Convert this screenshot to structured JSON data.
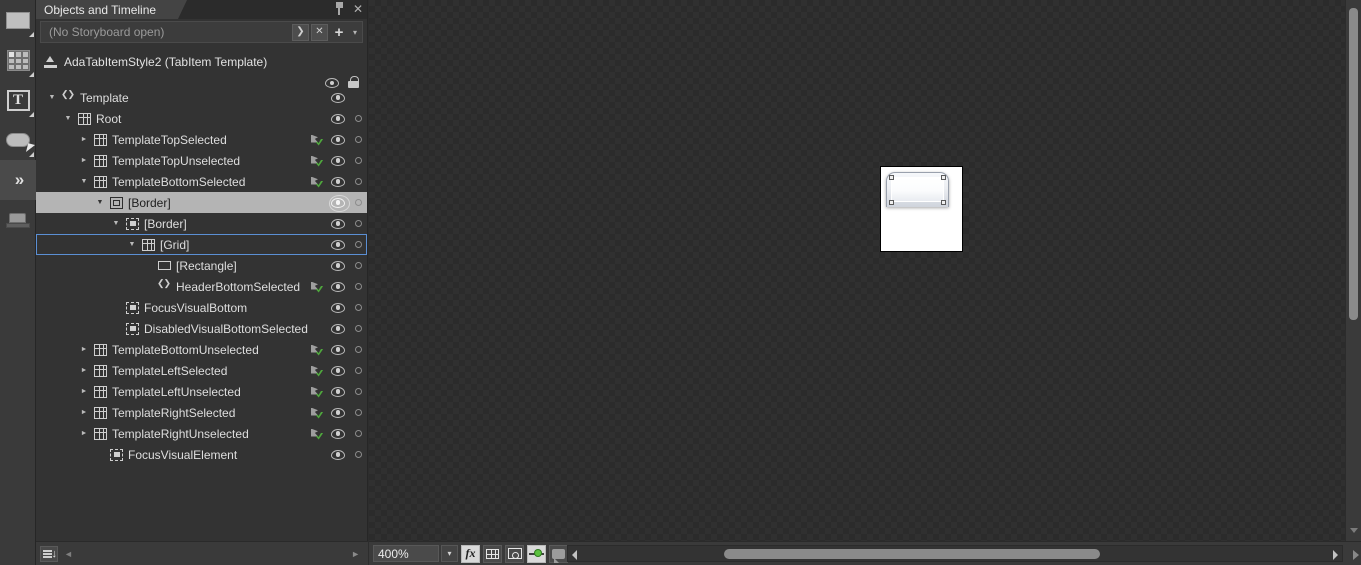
{
  "toolbar": {
    "tools": [
      {
        "name": "selection-rectangle-tool",
        "icon": "rectangle-icon"
      },
      {
        "name": "grid-panel-tool",
        "icon": "grid-icon"
      },
      {
        "name": "text-tool",
        "icon": "text-icon",
        "glyph": "T"
      },
      {
        "name": "button-control-tool",
        "icon": "button-icon"
      },
      {
        "name": "assets-tool",
        "icon": "double-chevron-right-icon",
        "glyph": "»"
      },
      {
        "name": "camera-3d-tool",
        "icon": "camera-icon"
      }
    ]
  },
  "panel": {
    "tab_label": "Objects and Timeline",
    "pin_tooltip": "Pin",
    "close_tooltip": "Close",
    "storyboard": {
      "value": "(No Storyboard open)",
      "placeholder": "(No Storyboard open)",
      "picker_glyph": "❯",
      "close_glyph": "✕",
      "new_glyph": "+",
      "menu_glyph": "▾"
    },
    "breadcrumb": "AdaTabItemStyle2 (TabItem Template)",
    "column_headers": {
      "visibility": "eye-icon",
      "lock": "lock-icon"
    },
    "tree": [
      {
        "label": "Template",
        "depth": 0,
        "twisty": "down",
        "icon": "template-icon",
        "anim": false,
        "eye": true,
        "lock": false,
        "selected": false,
        "focused": false
      },
      {
        "label": "Root",
        "depth": 1,
        "twisty": "down",
        "icon": "grid-icon",
        "anim": false,
        "eye": true,
        "lock": true,
        "selected": false,
        "focused": false
      },
      {
        "label": "TemplateTopSelected",
        "depth": 2,
        "twisty": "right",
        "icon": "grid-icon",
        "anim": true,
        "eye": true,
        "lock": true,
        "selected": false,
        "focused": false
      },
      {
        "label": "TemplateTopUnselected",
        "depth": 2,
        "twisty": "right",
        "icon": "grid-icon",
        "anim": true,
        "eye": true,
        "lock": true,
        "selected": false,
        "focused": false
      },
      {
        "label": "TemplateBottomSelected",
        "depth": 2,
        "twisty": "down",
        "icon": "grid-icon",
        "anim": true,
        "eye": true,
        "lock": true,
        "selected": false,
        "focused": false
      },
      {
        "label": "[Border]",
        "depth": 3,
        "twisty": "down",
        "icon": "border-icon",
        "anim": false,
        "eye": true,
        "lock": true,
        "selected": true,
        "focused": false
      },
      {
        "label": "[Border]",
        "depth": 4,
        "twisty": "down",
        "icon": "dashed-border-icon",
        "anim": false,
        "eye": true,
        "lock": true,
        "selected": false,
        "focused": false
      },
      {
        "label": "[Grid]",
        "depth": 5,
        "twisty": "down",
        "icon": "grid-icon",
        "anim": false,
        "eye": true,
        "lock": true,
        "selected": false,
        "focused": true
      },
      {
        "label": "[Rectangle]",
        "depth": 6,
        "twisty": "none",
        "icon": "rectangle-icon",
        "anim": false,
        "eye": true,
        "lock": true,
        "selected": false,
        "focused": false
      },
      {
        "label": "HeaderBottomSelected",
        "depth": 6,
        "twisty": "none",
        "icon": "template-icon",
        "anim": true,
        "eye": true,
        "lock": true,
        "selected": false,
        "focused": false
      },
      {
        "label": "FocusVisualBottom",
        "depth": 4,
        "twisty": "none",
        "icon": "dashed-border-icon",
        "anim": false,
        "eye": true,
        "lock": true,
        "selected": false,
        "focused": false
      },
      {
        "label": "DisabledVisualBottomSelected",
        "depth": 4,
        "twisty": "none",
        "icon": "dashed-border-icon",
        "anim": false,
        "eye": true,
        "lock": true,
        "selected": false,
        "focused": false
      },
      {
        "label": "TemplateBottomUnselected",
        "depth": 2,
        "twisty": "right",
        "icon": "grid-icon",
        "anim": true,
        "eye": true,
        "lock": true,
        "selected": false,
        "focused": false
      },
      {
        "label": "TemplateLeftSelected",
        "depth": 2,
        "twisty": "right",
        "icon": "grid-icon",
        "anim": true,
        "eye": true,
        "lock": true,
        "selected": false,
        "focused": false
      },
      {
        "label": "TemplateLeftUnselected",
        "depth": 2,
        "twisty": "right",
        "icon": "grid-icon",
        "anim": true,
        "eye": true,
        "lock": true,
        "selected": false,
        "focused": false
      },
      {
        "label": "TemplateRightSelected",
        "depth": 2,
        "twisty": "right",
        "icon": "grid-icon",
        "anim": true,
        "eye": true,
        "lock": true,
        "selected": false,
        "focused": false
      },
      {
        "label": "TemplateRightUnselected",
        "depth": 2,
        "twisty": "right",
        "icon": "grid-icon",
        "anim": true,
        "eye": true,
        "lock": true,
        "selected": false,
        "focused": false
      },
      {
        "label": "FocusVisualElement",
        "depth": 3,
        "twisty": "none",
        "icon": "dashed-border-icon",
        "anim": false,
        "eye": true,
        "lock": true,
        "selected": false,
        "focused": false
      }
    ],
    "bottom_bar": {
      "layers_icon": "show-all-layers-icon",
      "scroll_left_glyph": "◄",
      "scroll_right_glyph": "►"
    }
  },
  "canvas": {
    "artboard_label": "tab-item-preview",
    "scrollbars": {
      "h_left_glyph": "◄",
      "h_right_glyph": "►",
      "v_down_glyph": "▼"
    },
    "bottom_bar": {
      "zoom_value": "400%",
      "zoom_dropdown_glyph": "▾",
      "buttons": [
        {
          "name": "effects-toggle-button",
          "icon": "fx-icon",
          "glyph": "fx",
          "active": true
        },
        {
          "name": "show-grid-button",
          "icon": "grid-icon",
          "active": false
        },
        {
          "name": "snap-to-gridlines-button",
          "icon": "snap-icon",
          "active": false
        },
        {
          "name": "snap-to-snaplines-button",
          "icon": "align-icon",
          "active": true
        },
        {
          "name": "annotations-button",
          "icon": "comment-icon",
          "active": false
        }
      ],
      "collapse_glyph": "◄"
    }
  },
  "colors": {
    "panel_bg": "#333333",
    "toolbar_bg": "#3a3a3a",
    "selection_row": "#b4b4b4",
    "focus_outline": "#5b8fd4",
    "accent_green": "#5cc23f",
    "text": "#dedede"
  }
}
